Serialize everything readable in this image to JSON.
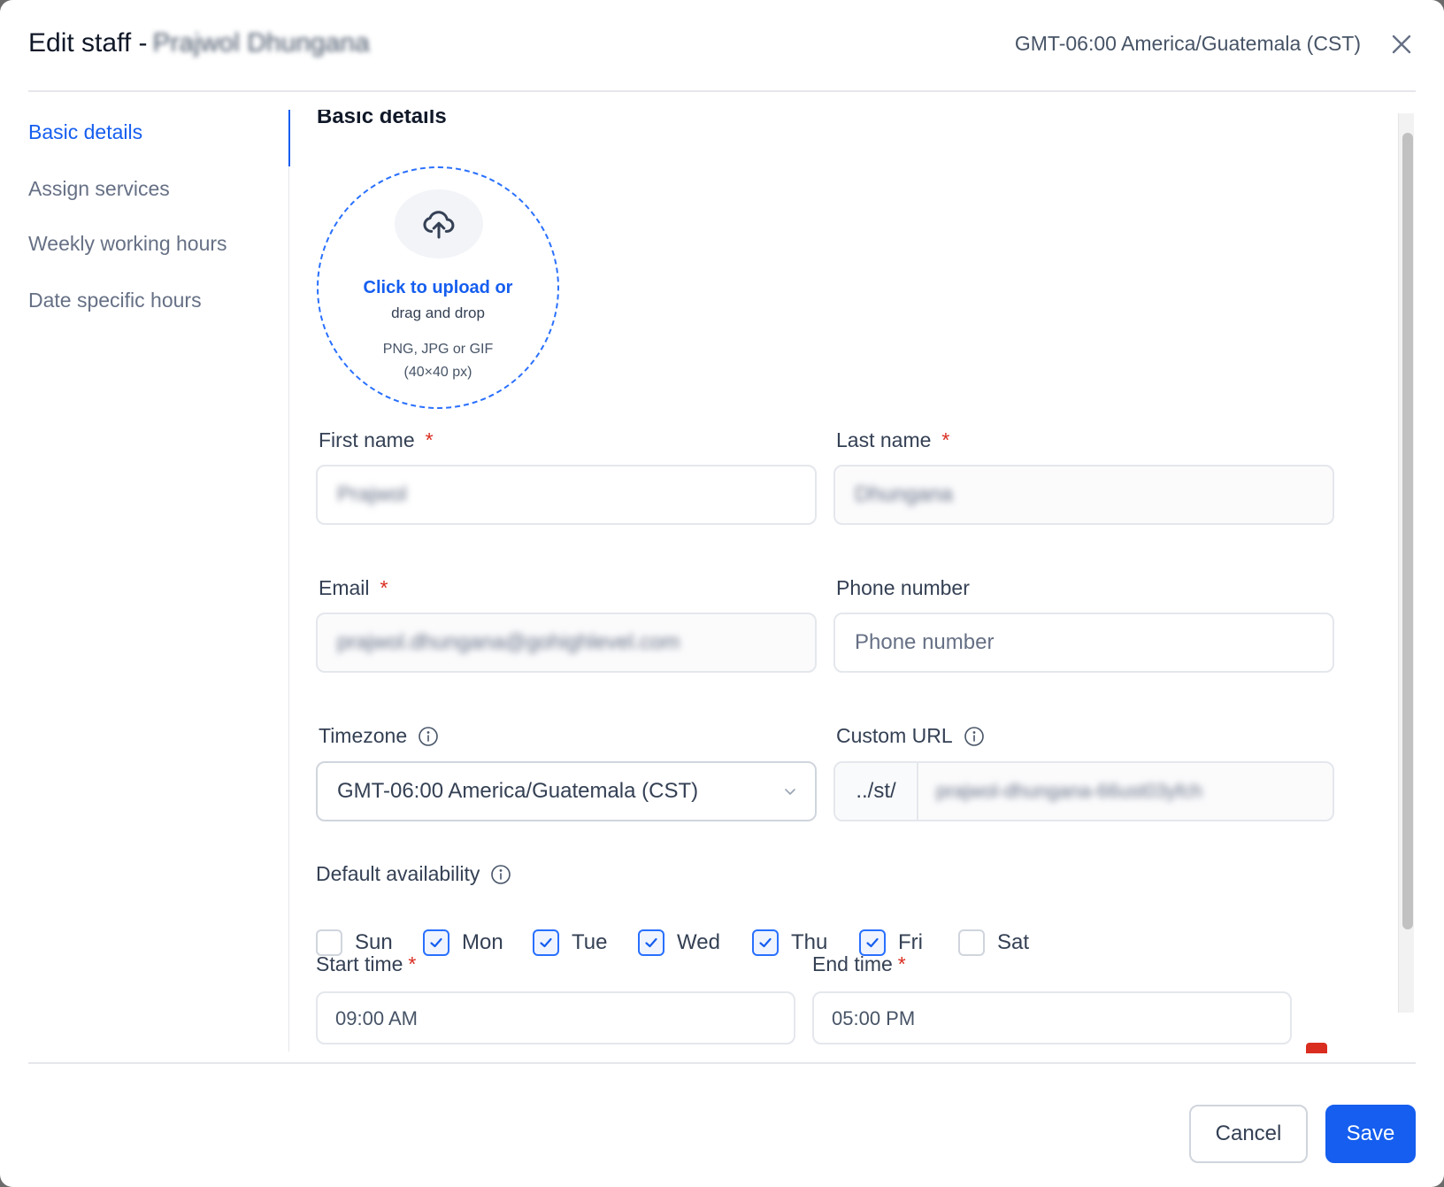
{
  "header": {
    "title_prefix": "Edit staff -",
    "staff_name": "Prajwol Dhungana",
    "timezone": "GMT-06:00 America/Guatemala (CST)"
  },
  "sidebar": {
    "items": [
      {
        "label": "Basic details",
        "active": true
      },
      {
        "label": "Assign services",
        "active": false
      },
      {
        "label": "Weekly working hours",
        "active": false
      },
      {
        "label": "Date specific hours",
        "active": false
      }
    ]
  },
  "section": {
    "title": "Basic details"
  },
  "upload": {
    "cta": "Click to upload or",
    "sub": "drag and drop",
    "formats": "PNG, JPG or GIF",
    "size": "(40×40 px)",
    "icon": "upload-cloud-icon"
  },
  "form": {
    "first_name": {
      "label": "First name",
      "value": "Prajwol"
    },
    "last_name": {
      "label": "Last name",
      "value": "Dhungana"
    },
    "email": {
      "label": "Email",
      "value": "prajwol.dhungana@gohighlevel.com"
    },
    "phone": {
      "label": "Phone number",
      "placeholder": "Phone number",
      "value": ""
    },
    "timezone": {
      "label": "Timezone",
      "value": "GMT-06:00 America/Guatemala (CST)"
    },
    "custom_url": {
      "label": "Custom URL",
      "prefix": "../st/",
      "value": "prajwol-dhungana-66ust03yfch"
    },
    "required_mark": "*"
  },
  "availability": {
    "label": "Default availability",
    "days": [
      {
        "label": "Sun",
        "checked": false
      },
      {
        "label": "Mon",
        "checked": true
      },
      {
        "label": "Tue",
        "checked": true
      },
      {
        "label": "Wed",
        "checked": true
      },
      {
        "label": "Thu",
        "checked": true
      },
      {
        "label": "Fri",
        "checked": true
      },
      {
        "label": "Sat",
        "checked": false
      }
    ]
  },
  "hours": {
    "start_label": "Start time",
    "start_value": "09:00 AM",
    "end_label": "End time",
    "end_value": "05:00 PM"
  },
  "footer": {
    "cancel_label": "Cancel",
    "save_label": "Save"
  },
  "colors": {
    "accent": "#155eef",
    "required": "#d92d20",
    "border": "#e4e7ec"
  }
}
